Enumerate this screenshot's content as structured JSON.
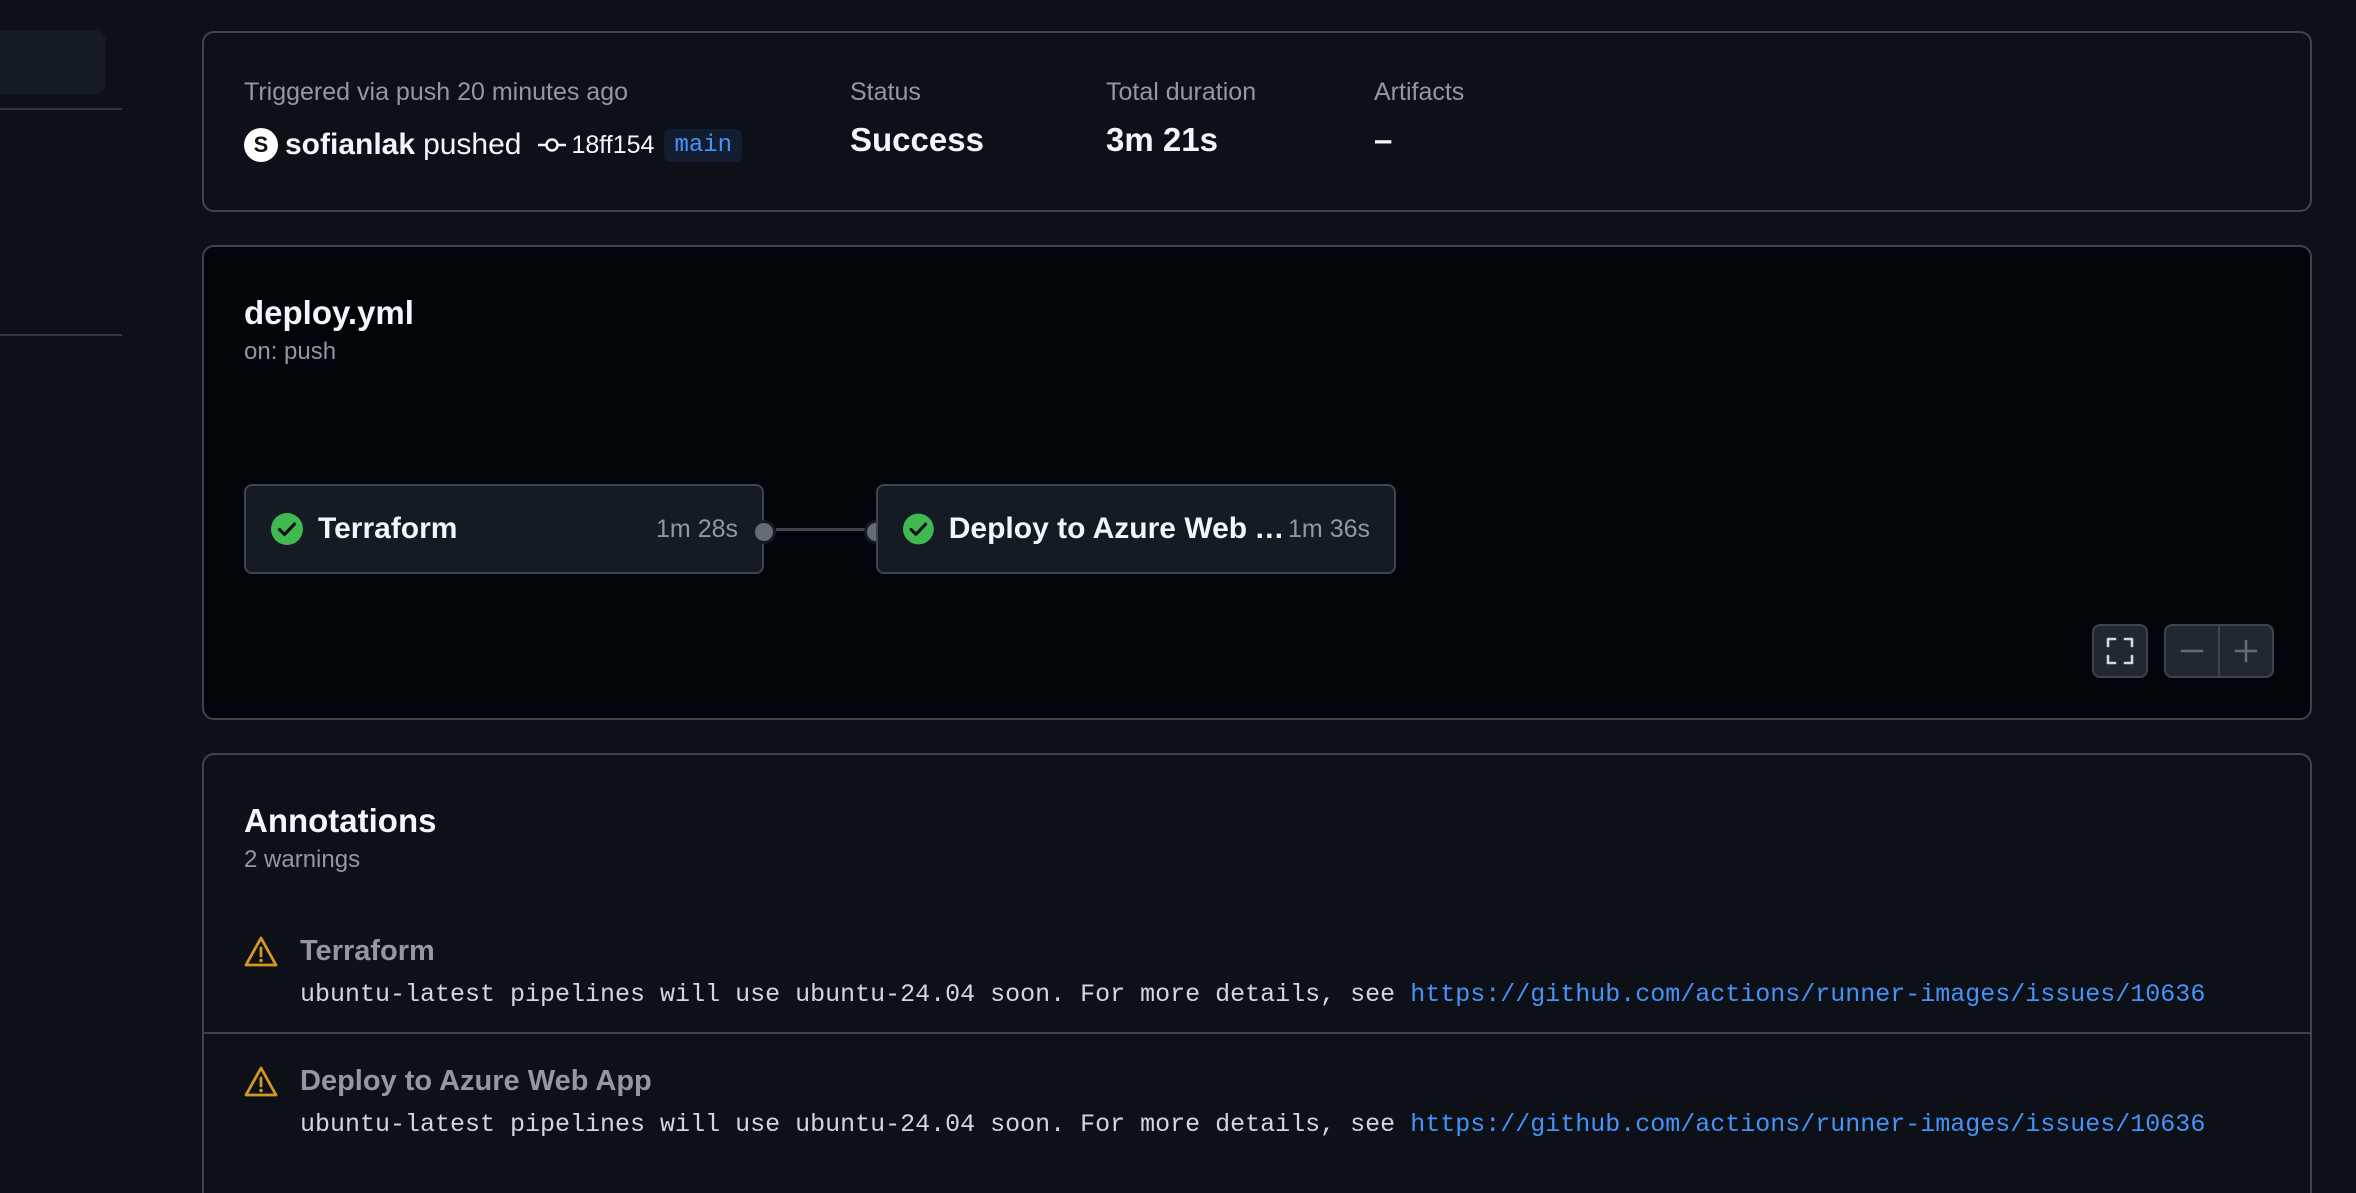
{
  "summary": {
    "trigger_label": "Triggered via push 20 minutes ago",
    "avatar_initial": "S",
    "actor": "sofianlak",
    "action": "pushed",
    "commit_sha": "18ff154",
    "branch": "main",
    "status_label": "Status",
    "status_value": "Success",
    "duration_label": "Total duration",
    "duration_value": "3m 21s",
    "artifacts_label": "Artifacts",
    "artifacts_value": "–"
  },
  "workflow": {
    "file": "deploy.yml",
    "trigger": "on: push",
    "jobs": [
      {
        "name": "Terraform",
        "duration": "1m 28s",
        "status": "success"
      },
      {
        "name": "Deploy to Azure Web A...",
        "duration": "1m 36s",
        "status": "success"
      }
    ],
    "controls": [
      "fullscreen-icon",
      "zoom-out-icon",
      "zoom-in-icon"
    ]
  },
  "annotations": {
    "title": "Annotations",
    "count_label": "2 warnings",
    "items": [
      {
        "job": "Terraform",
        "message": "ubuntu-latest pipelines will use ubuntu-24.04 soon. For more details, see ",
        "link": "https://github.com/actions/runner-images/issues/10636"
      },
      {
        "job": "Deploy to Azure Web App",
        "message": "ubuntu-latest pipelines will use ubuntu-24.04 soon. For more details, see ",
        "link": "https://github.com/actions/runner-images/issues/10636"
      }
    ]
  },
  "colors": {
    "background": "#0d1117",
    "success": "#3fb950",
    "warning": "#d29922",
    "link": "#4493f8",
    "border": "#3d444d"
  }
}
